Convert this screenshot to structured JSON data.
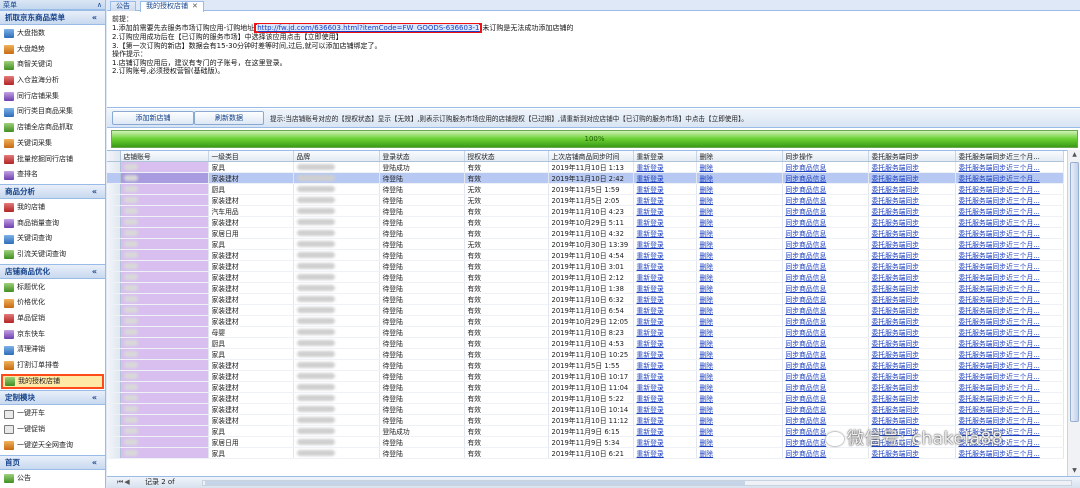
{
  "window": {
    "title": "菜单",
    "pin_glyph": "∧"
  },
  "sidebar": {
    "groups": [
      {
        "title": "抓取京东商品菜单",
        "collapse": "«",
        "items": [
          {
            "label": "大盘指数",
            "icon": "chart-icon"
          },
          {
            "label": "大盘趋势",
            "icon": "trend-icon"
          },
          {
            "label": "商智关键词",
            "icon": "search-icon"
          },
          {
            "label": "入仓监海分析",
            "icon": "warehouse-icon"
          },
          {
            "label": "同行店铺采集",
            "icon": "store-icon"
          },
          {
            "label": "同行类目商品采集",
            "icon": "category-icon"
          },
          {
            "label": "店铺全店商品抓取",
            "icon": "shop-icon"
          },
          {
            "label": "关键词采集",
            "icon": "keyword-icon"
          },
          {
            "label": "批量挖掘同行店铺",
            "icon": "mining-icon"
          },
          {
            "label": "查排名",
            "icon": "rank-icon"
          }
        ]
      },
      {
        "title": "商品分析",
        "collapse": "«",
        "items": [
          {
            "label": "我的店铺",
            "icon": "home-icon"
          },
          {
            "label": "商品销量查询",
            "icon": "sales-icon"
          },
          {
            "label": "关键词查询",
            "icon": "search-icon"
          },
          {
            "label": "引流关键词查询",
            "icon": "traffic-icon"
          }
        ]
      },
      {
        "title": "店铺商品优化",
        "collapse": "«",
        "items": [
          {
            "label": "标题优化",
            "icon": "title-icon"
          },
          {
            "label": "价格优化",
            "icon": "price-icon"
          },
          {
            "label": "单品促销",
            "icon": "promo-icon"
          },
          {
            "label": "京东快车",
            "icon": "car-icon"
          },
          {
            "label": "清理滞销",
            "icon": "clean-icon"
          },
          {
            "label": "打割订单排卷",
            "icon": "order-icon"
          },
          {
            "label": "我的授权店铺",
            "icon": "auth-icon",
            "selected": true
          }
        ]
      },
      {
        "title": "定制模块",
        "collapse": "«",
        "items": [
          {
            "label": "一键开车",
            "icon": "plus-icon"
          },
          {
            "label": "一键促销",
            "icon": "plus-icon"
          },
          {
            "label": "一键逆天全网查询",
            "icon": "query-icon"
          }
        ]
      },
      {
        "title": "首页",
        "collapse": "«",
        "items": [
          {
            "label": "公告",
            "icon": "notice-icon"
          }
        ]
      }
    ]
  },
  "tabs": [
    {
      "label": "公告",
      "active": false
    },
    {
      "label": "我的授权店铺",
      "active": true,
      "close": "✕"
    }
  ],
  "notice": {
    "heading": "前提：",
    "line1_pre": "1.添加前需要先去服务市场订购应用-订购地址",
    "line1_link": "http://fw.jd.com/636603.html?itemCode=FW_GOODS-636603-1",
    "line1_post": "未订购是无法成功添加店铺的",
    "line2": "2.订购应用成功后在【已订购的服务市场】中选择该应用点击【立即使用】",
    "line3": "3.【第一次订购的新店】数据会有15-30分钟时差等时间,过后,就可以添加店铺绑定了。",
    "blank": "",
    "tips_heading": "操作提示：",
    "tip1": "1.店铺订购应用后，建议有专门的子账号，在这里登录。",
    "tip2": "2.订购账号,必须授权营智(基础版)。"
  },
  "toolbar": {
    "add_label": "添加新店铺",
    "refresh_label": "刷新数据",
    "hint": "提示:当店铺账号对应的【授权状态】显示【无效】,则表示订购服务市场应用的店铺授权【已过期】,请重新到对应店铺中【已订购的服务市场】中点击【立即使用】。"
  },
  "progress": {
    "value": 1.0,
    "label": "100%"
  },
  "grid": {
    "columns": [
      "店铺账号",
      "一级类目",
      "品牌",
      "登录状态",
      "授权状态",
      "上次店铺商品同步时间",
      "重新登录",
      "删除",
      "同步操作",
      "委托服务端同步",
      "委托服务端同步近三个月..."
    ],
    "rows": [
      {
        "cat": "家具",
        "login": "登陆成功",
        "auth": "有效",
        "time": "2019年11月10日 1:13"
      },
      {
        "cat": "家装建材",
        "login": "待登陆",
        "auth": "有效",
        "time": "2019年11月10日 2:42",
        "selected": true
      },
      {
        "cat": "厨具",
        "login": "待登陆",
        "auth": "无效",
        "time": "2019年11月5日 1:59"
      },
      {
        "cat": "家装建材",
        "login": "待登陆",
        "auth": "无效",
        "time": "2019年11月5日 2:05"
      },
      {
        "cat": "汽车用品",
        "login": "待登陆",
        "auth": "有效",
        "time": "2019年11月10日 4:23"
      },
      {
        "cat": "家装建材",
        "login": "待登陆",
        "auth": "有效",
        "time": "2019年10月29日 5:11"
      },
      {
        "cat": "家居日用",
        "login": "待登陆",
        "auth": "有效",
        "time": "2019年11月10日 4:32"
      },
      {
        "cat": "家具",
        "login": "待登陆",
        "auth": "无效",
        "time": "2019年10月30日 13:39"
      },
      {
        "cat": "家装建材",
        "login": "待登陆",
        "auth": "有效",
        "time": "2019年11月10日 4:54"
      },
      {
        "cat": "家装建材",
        "login": "待登陆",
        "auth": "有效",
        "time": "2019年11月10日 3:01"
      },
      {
        "cat": "家装建材",
        "login": "待登陆",
        "auth": "有效",
        "time": "2019年11月10日 2:12"
      },
      {
        "cat": "家装建材",
        "login": "待登陆",
        "auth": "有效",
        "time": "2019年11月10日 1:38"
      },
      {
        "cat": "家装建材",
        "login": "待登陆",
        "auth": "有效",
        "time": "2019年11月10日 6:32"
      },
      {
        "cat": "家装建材",
        "login": "待登陆",
        "auth": "有效",
        "time": "2019年11月10日 6:54"
      },
      {
        "cat": "家装建材",
        "login": "待登陆",
        "auth": "有效",
        "time": "2019年10月29日 12:05"
      },
      {
        "cat": "母婴",
        "login": "待登陆",
        "auth": "有效",
        "time": "2019年11月10日 8:23"
      },
      {
        "cat": "厨具",
        "login": "待登陆",
        "auth": "有效",
        "time": "2019年11月10日 4:53"
      },
      {
        "cat": "家具",
        "login": "待登陆",
        "auth": "有效",
        "time": "2019年11月10日 10:25"
      },
      {
        "cat": "家装建材",
        "login": "待登陆",
        "auth": "有效",
        "time": "2019年11月5日 1:55"
      },
      {
        "cat": "家装建材",
        "login": "待登陆",
        "auth": "有效",
        "time": "2019年11月10日 10:17"
      },
      {
        "cat": "家装建材",
        "login": "待登陆",
        "auth": "有效",
        "time": "2019年11月10日 11:04"
      },
      {
        "cat": "家装建材",
        "login": "待登陆",
        "auth": "有效",
        "time": "2019年11月10日 5:22"
      },
      {
        "cat": "家装建材",
        "login": "待登陆",
        "auth": "有效",
        "time": "2019年11月10日 10:14"
      },
      {
        "cat": "家装建材",
        "login": "待登陆",
        "auth": "有效",
        "time": "2019年11月10日 11:12"
      },
      {
        "cat": "家具",
        "login": "登陆成功",
        "auth": "有效",
        "time": "2019年11月9日 6:15"
      },
      {
        "cat": "家居日用",
        "login": "待登陆",
        "auth": "有效",
        "time": "2019年11月9日 5:34"
      },
      {
        "cat": "家具",
        "login": "待登陆",
        "auth": "有效",
        "time": "2019年11月10日 6:21"
      }
    ],
    "relogin_label": "重新登录",
    "delete_label": "删除",
    "sync_label": "同步商品信息",
    "delegate_label": "委托服务端同步",
    "delegate3_label": "委托服务端同步近三个月..."
  },
  "pager": {
    "nav": "⏮◀",
    "record": "记录 2 of"
  },
  "watermark": {
    "text": "微信号: chakela88"
  },
  "colors": {
    "accent": "#15428b",
    "highlight_border": "#e11111",
    "selected_row": "#b7c9f2",
    "account_cell": "#d9bff0",
    "progress": "#4caf1f"
  }
}
